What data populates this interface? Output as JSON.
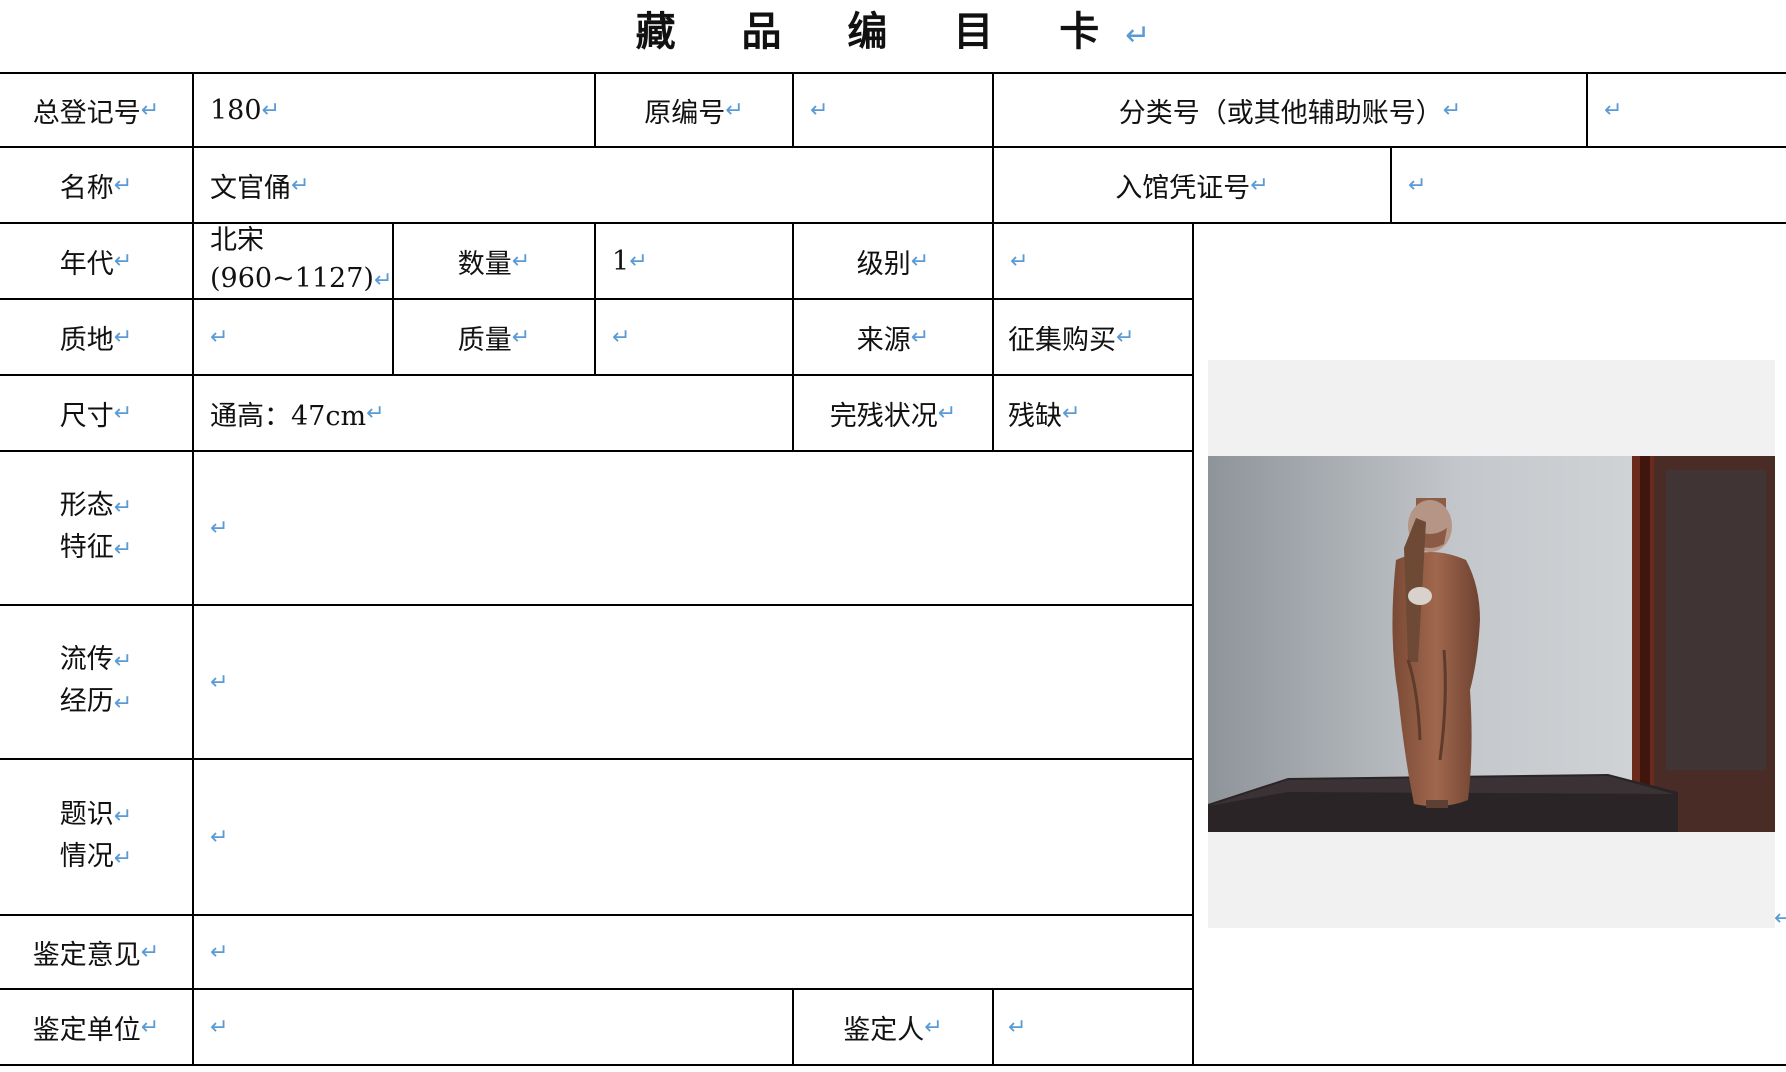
{
  "title": "藏 品 编 目 卡",
  "return_mark": "↵",
  "labels": {
    "registration_no": "总登记号",
    "original_no": "原编号",
    "classification_no": "分类号（或其他辅助账号）",
    "name": "名称",
    "entry_voucher_no": "入馆凭证号",
    "era": "年代",
    "quantity": "数量",
    "grade": "级别",
    "material": "质地",
    "weight": "质量",
    "source": "来源",
    "size": "尺寸",
    "condition": "完残状况",
    "form_line1": "形态",
    "form_line2": "特征",
    "history_line1": "流传",
    "history_line2": "经历",
    "inscription_line1": "题识",
    "inscription_line2": "情况",
    "appraisal_opinion": "鉴定意见",
    "appraisal_unit": "鉴定单位",
    "appraiser": "鉴定人"
  },
  "values": {
    "registration_no": "180",
    "name": "文官俑",
    "era_line1": "北宋",
    "era_line2": "(960~1127)",
    "quantity": "1",
    "source": "征集购买",
    "size": "通高：47cm",
    "condition": "残缺"
  },
  "colors": {
    "return_mark": "#5b9bd5",
    "grid_line": "#000000"
  }
}
